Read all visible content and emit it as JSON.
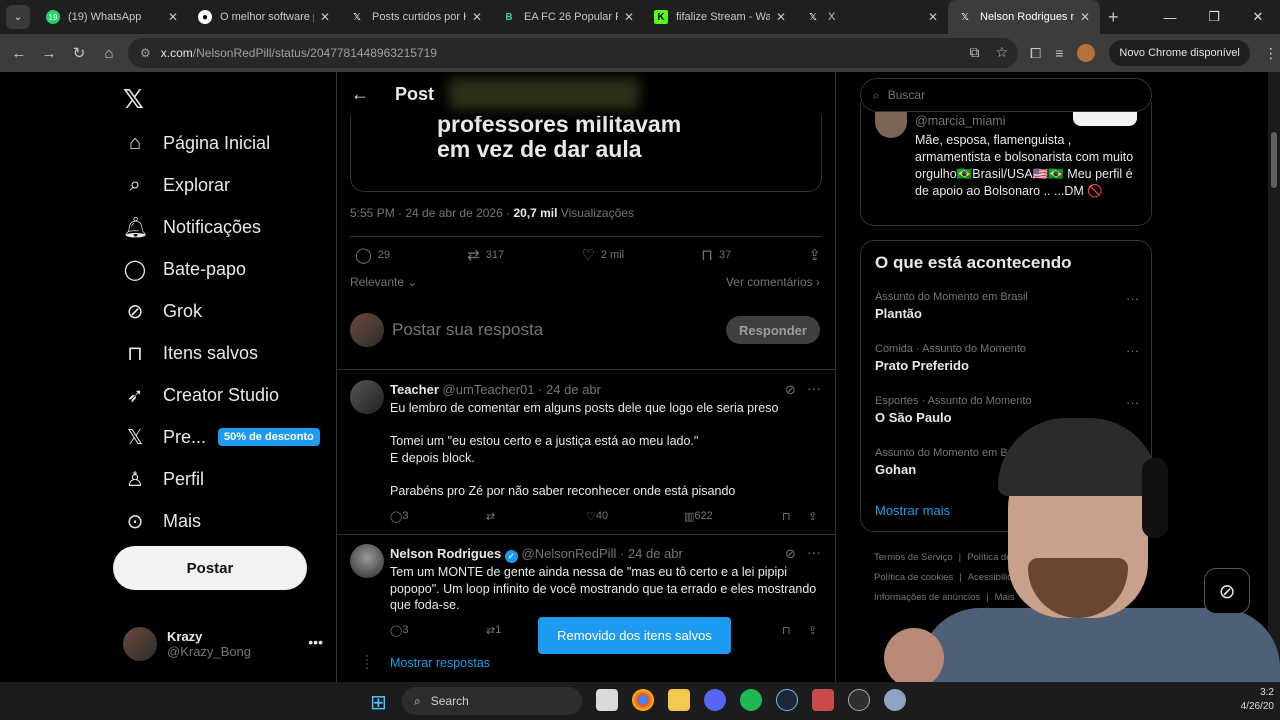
{
  "browser": {
    "tabs": [
      {
        "title": "(19) WhatsApp",
        "active": false,
        "badge": "19"
      },
      {
        "title": "O melhor software p",
        "active": false
      },
      {
        "title": "Posts curtidos por Kr",
        "active": false
      },
      {
        "title": "EA FC 26 Popular Pla",
        "active": false
      },
      {
        "title": "fifalize Stream - Wat",
        "active": false
      },
      {
        "title": "X",
        "active": false
      },
      {
        "title": "Nelson Rodrigues no",
        "active": true
      }
    ],
    "url_host": "x.com",
    "url_path": "/NelsonRedPill/status/2047781448963215719",
    "update_label": "Novo Chrome disponível"
  },
  "nav": {
    "items": [
      {
        "label": "Página Inicial",
        "icon": "home-icon"
      },
      {
        "label": "Explorar",
        "icon": "search-icon"
      },
      {
        "label": "Notificações",
        "icon": "bell-icon"
      },
      {
        "label": "Bate-papo",
        "icon": "chat-icon"
      },
      {
        "label": "Grok",
        "icon": "grok-icon"
      },
      {
        "label": "Itens salvos",
        "icon": "bookmark-icon"
      },
      {
        "label": "Creator Studio",
        "icon": "rocket-icon"
      },
      {
        "label": "Pre...",
        "icon": "x-logo-icon",
        "promo": "50% de desconto"
      },
      {
        "label": "Perfil",
        "icon": "person-icon"
      },
      {
        "label": "Mais",
        "icon": "more-circle-icon"
      }
    ],
    "post_label": "Postar",
    "account": {
      "name": "Krazy",
      "handle": "@Krazy_Bong"
    }
  },
  "post": {
    "header_title": "Post",
    "quote_text_line1": "professores militavam",
    "quote_text_line2": "em vez de dar aula",
    "timestamp": "5:55 PM · 24 de abr de 2026 · ",
    "views_count": "20,7 mil",
    "views_label": " Visualizações",
    "stats": {
      "replies": "29",
      "reposts": "317",
      "likes": "2 mil",
      "bookmarks": "37"
    },
    "sort_label": "Relevante",
    "comments_link": "Ver comentários",
    "reply_placeholder": "Postar sua resposta",
    "reply_button": "Responder"
  },
  "replies": [
    {
      "name": "Teacher",
      "handle": "@umTeacher01 · 24 de abr",
      "body": "Eu lembro de comentar em alguns posts dele que logo ele seria preso\n\nTomei um \"eu estou certo e a justiça está ao meu lado.\"\nE depois block.\n\nParabéns pro Zé por não saber reconhecer onde está pisando",
      "replies": "3",
      "reposts": "",
      "likes": "40",
      "views": "622"
    },
    {
      "name": "Nelson Rodrigues",
      "handle": "@NelsonRedPill · 24 de abr",
      "body": "Tem um MONTE de gente ainda nessa de \"mas eu tô certo e a lei pipipi popopo\". Um loop infinito de você mostrando que ta errado e eles mostrando que foda-se.",
      "replies": "3",
      "reposts": "1"
    }
  ],
  "toast": "Removido dos itens salvos",
  "show_replies": "Mostrar respostas",
  "right": {
    "search_placeholder": "Buscar",
    "who": {
      "handle": "@marcia_miami",
      "bio": "Mãe, esposa, flamenguista , armamentista e bolsonarista com muito orgulho🇧🇷Brasil/USA🇺🇸🇧🇷 Meu perfil é de apoio ao Bolsonaro .. ...DM 🚫"
    },
    "trends_title": "O que está acontecendo",
    "trends": [
      {
        "context": "Assunto do Momento em Brasil",
        "topic": "Plantão"
      },
      {
        "context": "Comida · Assunto do Momento",
        "topic": "Prato Preferido"
      },
      {
        "context": "Esportes · Assunto do Momento",
        "topic": "O São Paulo"
      },
      {
        "context": "Assunto do Momento em Brasil",
        "topic": "Gohan"
      }
    ],
    "show_more": "Mostrar mais",
    "footer": [
      "Termos de Serviço",
      "|",
      "Política de Priva",
      "Política de cookies",
      "|",
      "Acessibilidade",
      "Informações de anúncios",
      "|",
      "Mais"
    ]
  },
  "taskbar": {
    "search_label": "Search",
    "time": "3:2",
    "date": "4/26/20"
  },
  "colors": {
    "accent": "#1d9bf0",
    "background": "#000000",
    "border": "#2f3336",
    "muted": "#71767b"
  }
}
